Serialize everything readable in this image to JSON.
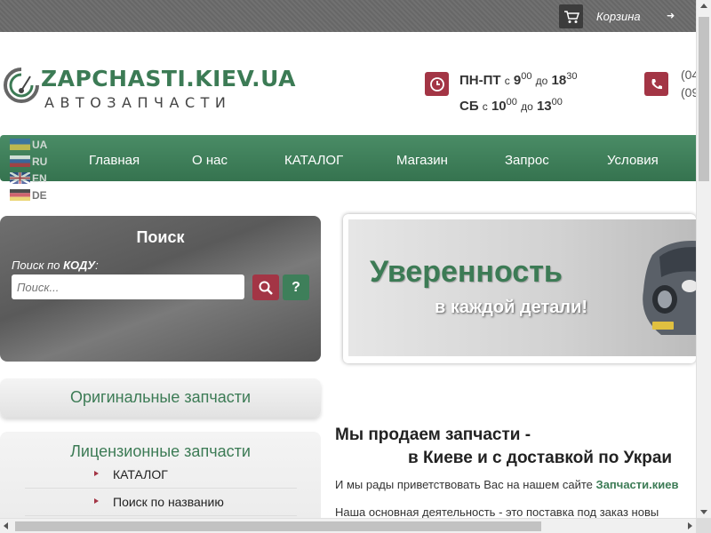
{
  "topbar": {
    "cart_label": "Корзина",
    "cart_icon": "cart-icon",
    "login_icon": "login-icon"
  },
  "logo": {
    "title": "ZAPCHASTI.KIEV.UA",
    "subtitle": "АВТОЗАПЧАСТИ",
    "icon": "speedometer-icon"
  },
  "hours": {
    "icon": "clock-icon",
    "weekdays_label": "ПН-ПТ",
    "weekdays_from_word": "с",
    "weekdays_from_h": "9",
    "weekdays_from_m": "00",
    "weekdays_to_word": "до",
    "weekdays_to_h": "18",
    "weekdays_to_m": "30",
    "saturday_label": "СБ",
    "saturday_from_word": "с",
    "saturday_from_h": "10",
    "saturday_from_m": "00",
    "saturday_to_word": "до",
    "saturday_to_h": "13",
    "saturday_to_m": "00"
  },
  "contacts": {
    "icon": "phone-icon",
    "phone_1": "(04",
    "phone_2": "(09"
  },
  "languages": [
    {
      "code": "UA",
      "flag_icon": "ukraine-flag-icon"
    },
    {
      "code": "RU",
      "flag_icon": "russia-flag-icon"
    },
    {
      "code": "EN",
      "flag_icon": "uk-flag-icon"
    },
    {
      "code": "DE",
      "flag_icon": "germany-flag-icon"
    }
  ],
  "nav": {
    "items": [
      "Главная",
      "О нас",
      "КАТАЛОГ",
      "Магазин",
      "Запрос",
      "Условия"
    ]
  },
  "search": {
    "title": "Поиск",
    "code_prefix": "Поиск по",
    "code_word": "КОДУ",
    "code_suffix": ":",
    "placeholder": "Поиск...",
    "search_button_icon": "magnifier-icon",
    "help_button_label": "?"
  },
  "sidebar": {
    "original_title": "Оригинальные запчасти",
    "license_title": "Лицензионные запчасти",
    "license_items": [
      "КАТАЛОГ",
      "Поиск по названию"
    ]
  },
  "banner": {
    "headline": "Уверенность",
    "subline": "в каждой детали!",
    "image": "car-image"
  },
  "main": {
    "heading_line1": "Мы продаем запчасти -",
    "heading_line2": "в Киеве и с доставкой по Украи",
    "greeting_prefix": "И мы рады приветствовать Вас на нашем сайте",
    "greeting_site": "Запчасти.киев",
    "paragraph": "Наша основная деятельность - это поставка под заказ новы"
  },
  "colors": {
    "brand_green": "#3e7f5a",
    "accent_red": "#a33545",
    "topbar_gray": "#6b6b6b"
  }
}
